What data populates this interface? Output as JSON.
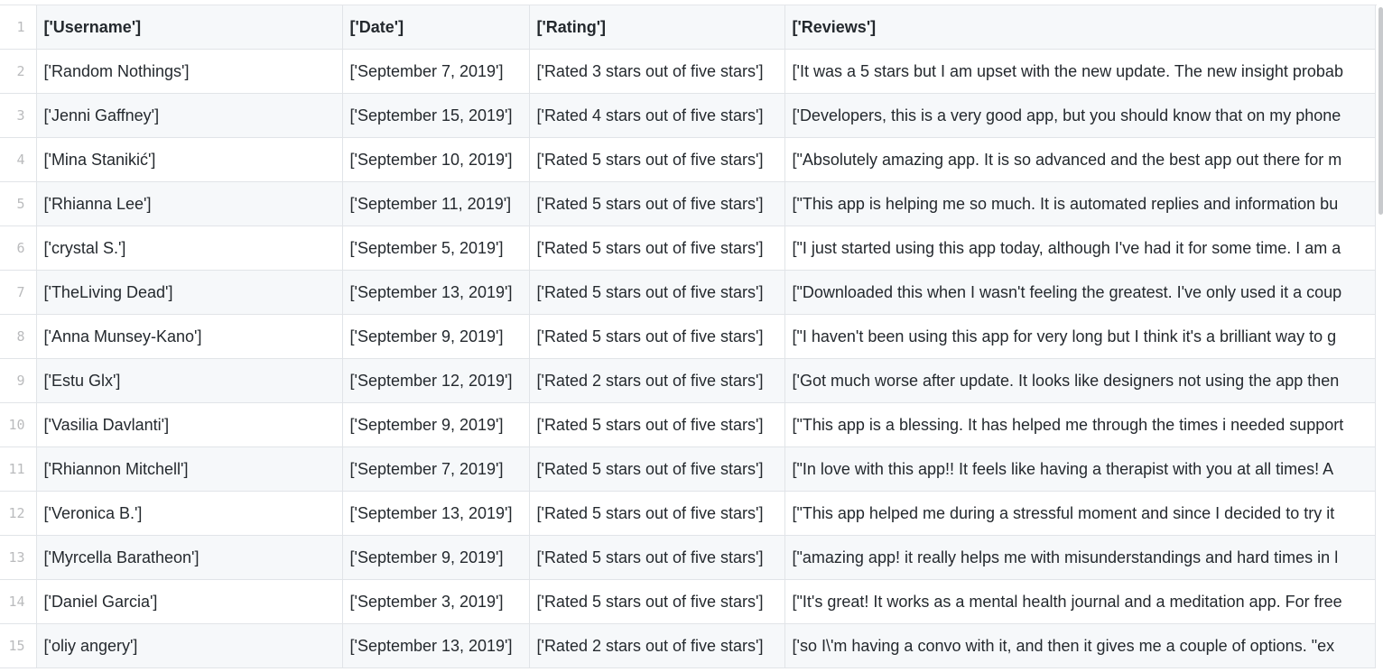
{
  "table": {
    "header": {
      "row_number": "1",
      "columns": [
        "['Username']",
        "['Date']",
        "['Rating']",
        "['Reviews']"
      ]
    },
    "rows": [
      {
        "n": "2",
        "username": "['Random Nothings']",
        "date": "['September 7, 2019']",
        "rating": "['Rated 3 stars out of five stars']",
        "review": "['It was a 5 stars but I am upset with the new update. The new insight probab"
      },
      {
        "n": "3",
        "username": "['Jenni Gaffney']",
        "date": "['September 15, 2019']",
        "rating": "['Rated 4 stars out of five stars']",
        "review": "['Developers, this is a very good app, but you should know that on my phone"
      },
      {
        "n": "4",
        "username": "['Mina Stanikić']",
        "date": "['September 10, 2019']",
        "rating": "['Rated 5 stars out of five stars']",
        "review": "[\"Absolutely amazing app. It is so advanced and the best app out there for m"
      },
      {
        "n": "5",
        "username": "['Rhianna Lee']",
        "date": "['September 11, 2019']",
        "rating": "['Rated 5 stars out of five stars']",
        "review": "[\"This app is helping me so much. It is automated replies and information bu"
      },
      {
        "n": "6",
        "username": "['crystal S.']",
        "date": "['September 5, 2019']",
        "rating": "['Rated 5 stars out of five stars']",
        "review": "[\"I just started using this app today, although I've had it for some time. I am a"
      },
      {
        "n": "7",
        "username": "['TheLiving Dead']",
        "date": "['September 13, 2019']",
        "rating": "['Rated 5 stars out of five stars']",
        "review": "[\"Downloaded this when I wasn't feeling the greatest. I've only used it a coup"
      },
      {
        "n": "8",
        "username": "['Anna Munsey-Kano']",
        "date": "['September 9, 2019']",
        "rating": "['Rated 5 stars out of five stars']",
        "review": "[\"I haven't been using this app for very long but I think it's a brilliant way to g"
      },
      {
        "n": "9",
        "username": "['Estu Glx']",
        "date": "['September 12, 2019']",
        "rating": "['Rated 2 stars out of five stars']",
        "review": "['Got much worse after update. It looks like designers not using the app then"
      },
      {
        "n": "10",
        "username": "['Vasilia Davlanti']",
        "date": "['September 9, 2019']",
        "rating": "['Rated 5 stars out of five stars']",
        "review": "[\"This app is a blessing. It has helped me through the times i needed support"
      },
      {
        "n": "11",
        "username": "['Rhiannon Mitchell']",
        "date": "['September 7, 2019']",
        "rating": "['Rated 5 stars out of five stars']",
        "review": "[\"In love with this app!! It feels like having a therapist with you at all times! A"
      },
      {
        "n": "12",
        "username": "['Veronica B.']",
        "date": "['September 13, 2019']",
        "rating": "['Rated 5 stars out of five stars']",
        "review": "[\"This app helped me during a stressful moment and since I decided to try it"
      },
      {
        "n": "13",
        "username": "['Myrcella Baratheon']",
        "date": "['September 9, 2019']",
        "rating": "['Rated 5 stars out of five stars']",
        "review": "[\"amazing app! it really helps me with misunderstandings and hard times in l"
      },
      {
        "n": "14",
        "username": "['Daniel Garcia']",
        "date": "['September 3, 2019']",
        "rating": "['Rated 5 stars out of five stars']",
        "review": "[\"It's great! It works as a mental health journal and a meditation app. For free"
      },
      {
        "n": "15",
        "username": "['oliy angery']",
        "date": "['September 13, 2019']",
        "rating": "['Rated 2 stars out of five stars']",
        "review": "['so I\\'m having a convo with it, and then it gives me a couple of options. \"ex"
      }
    ]
  }
}
